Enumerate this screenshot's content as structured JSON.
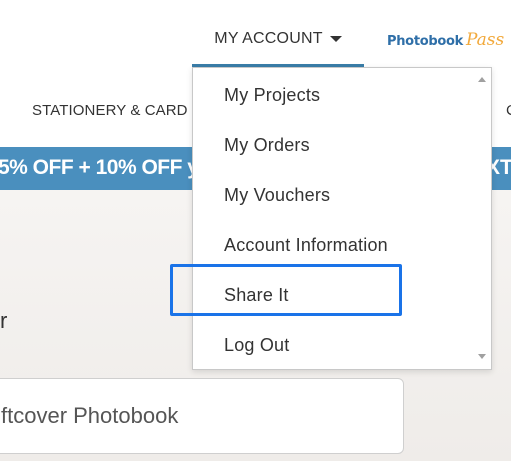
{
  "header": {
    "account_label": "MY ACCOUNT",
    "logo_word": "Photobook",
    "logo_script": "Pass"
  },
  "nav": {
    "categories": [
      "STATIONERY & CARD",
      "C"
    ]
  },
  "promo": {
    "left_text": "5% OFF + 10% OFF y",
    "right_text": "XT"
  },
  "account_menu": {
    "items": [
      "My Projects",
      "My Orders",
      "My Vouchers",
      "Account Information",
      "Share It",
      "Log Out"
    ],
    "highlighted": "Share It"
  },
  "content": {
    "heading_fragment": "r",
    "product_field_value": "ftcover Photobook"
  },
  "colors": {
    "accent": "#3a7da8",
    "promo_bg": "#4a8fbe",
    "highlight": "#1a73e8",
    "logo_blue": "#2f6fa8",
    "logo_orange": "#f2a93b"
  }
}
